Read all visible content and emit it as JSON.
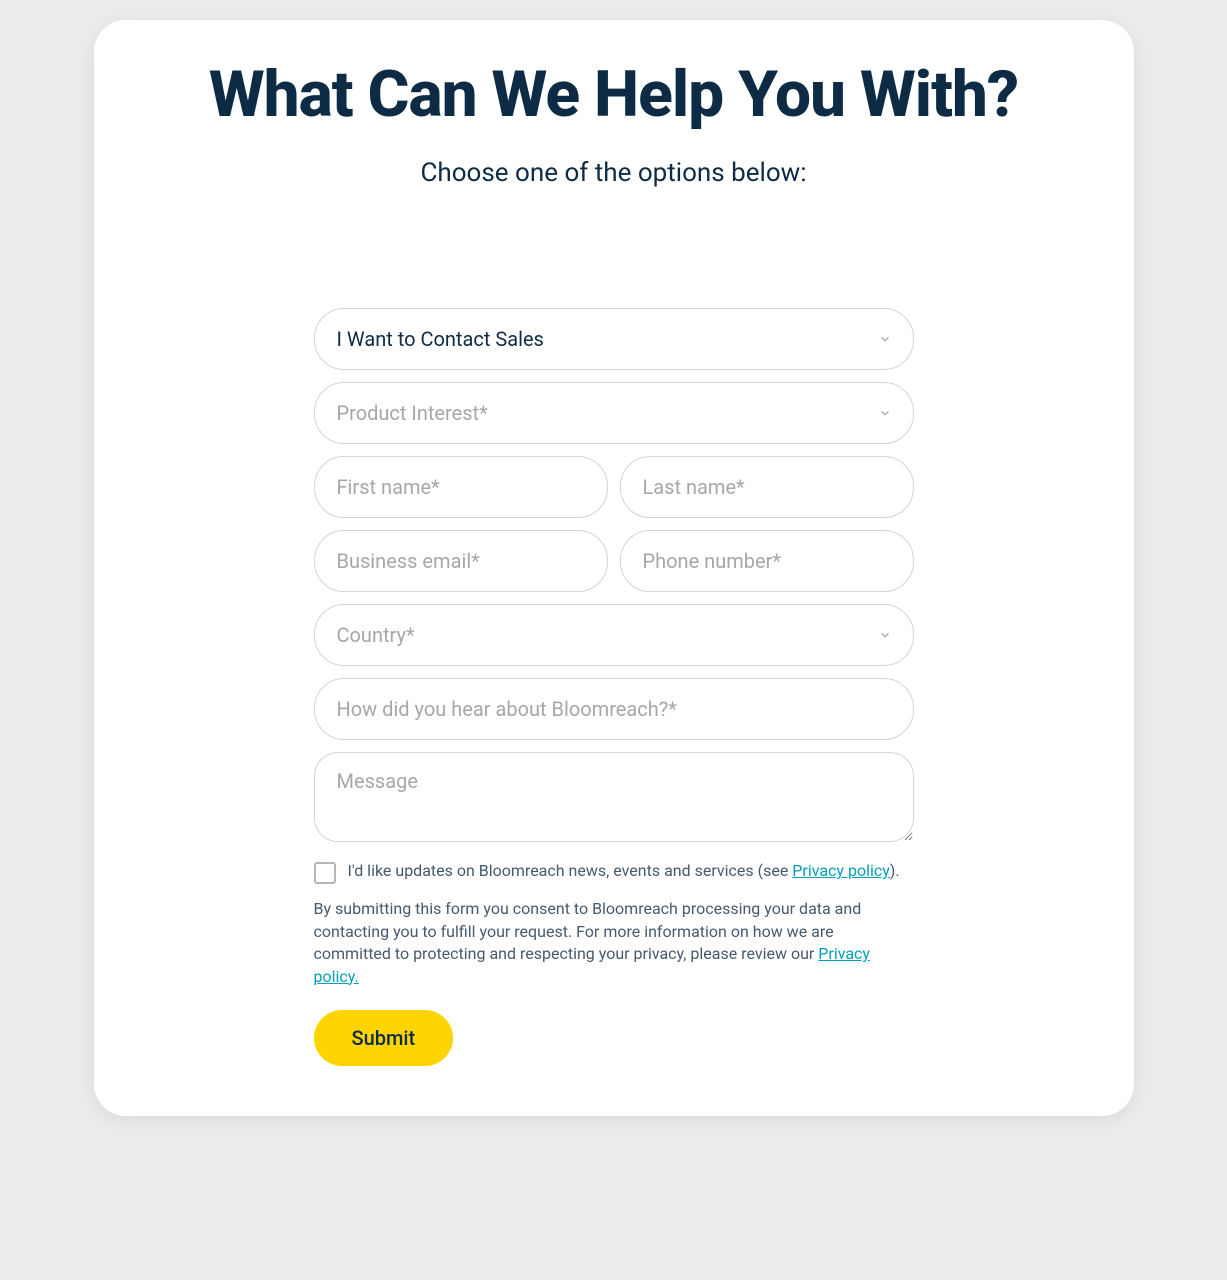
{
  "header": {
    "title": "What Can We Help You With?",
    "subtitle": "Choose one of the options below:"
  },
  "form": {
    "topic_select": {
      "selected": "I Want to Contact Sales"
    },
    "product_interest": {
      "placeholder": "Product Interest*"
    },
    "first_name": {
      "placeholder": "First name*"
    },
    "last_name": {
      "placeholder": "Last name*"
    },
    "business_email": {
      "placeholder": "Business email*"
    },
    "phone": {
      "placeholder": "Phone number*"
    },
    "country": {
      "placeholder": "Country*"
    },
    "hear_about": {
      "placeholder": "How did you hear about Bloomreach?*"
    },
    "message": {
      "placeholder": "Message"
    },
    "checkbox_label_prefix": "I'd like updates on Bloomreach news, events and services (see ",
    "privacy_link_text": "Privacy policy",
    "checkbox_label_suffix": ").",
    "disclaimer_prefix": "By submitting this form you consent to Bloomreach processing your data and contacting you to fulfill your request. For more information on how we are committed to protecting and respecting your privacy, please review our ",
    "disclaimer_link_text": "Privacy policy.",
    "submit_label": "Submit"
  }
}
